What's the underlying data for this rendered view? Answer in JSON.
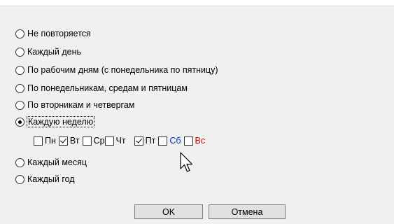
{
  "recurrence_options": [
    {
      "label": "Не повторяется",
      "selected": false
    },
    {
      "label": "Каждый день",
      "selected": false
    },
    {
      "label": "По рабочим дням (с понедельника по пятницу)",
      "selected": false
    },
    {
      "label": "По понедельникам, средам и пятницам",
      "selected": false
    },
    {
      "label": "По вторникам и четвергам",
      "selected": false
    },
    {
      "label": "Каждую неделю",
      "selected": true
    },
    {
      "label": "Каждый месяц",
      "selected": false
    },
    {
      "label": "Каждый год",
      "selected": false
    }
  ],
  "weekdays": [
    {
      "label": "Пн",
      "checked": false,
      "color": "#000000"
    },
    {
      "label": "Вт",
      "checked": true,
      "color": "#000000"
    },
    {
      "label": "Ср",
      "checked": false,
      "color": "#000000"
    },
    {
      "label": "Чт",
      "checked": false,
      "color": "#000000"
    },
    {
      "label": "Пт",
      "checked": true,
      "color": "#000000"
    },
    {
      "label": "Сб",
      "checked": false,
      "color": "#0033cc"
    },
    {
      "label": "Вс",
      "checked": false,
      "color": "#d40000"
    }
  ],
  "buttons": {
    "ok_label": "OK",
    "cancel_label": "Отмена"
  }
}
